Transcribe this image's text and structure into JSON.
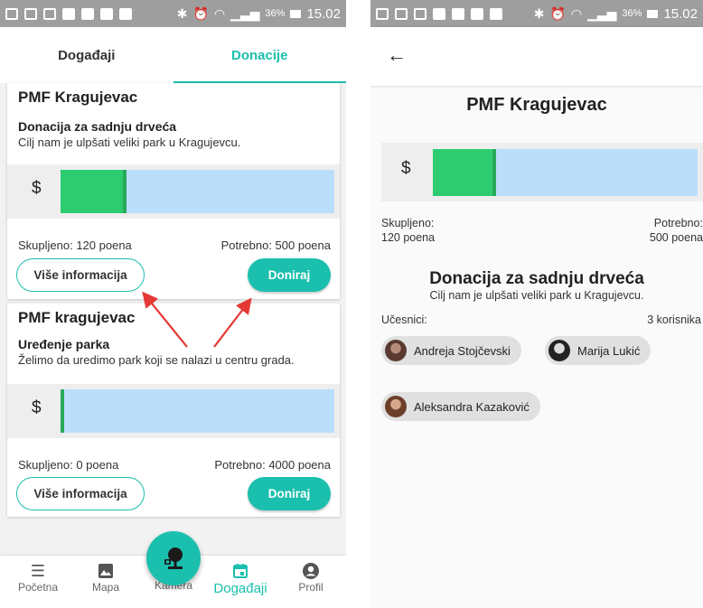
{
  "status_bar": {
    "battery": "36%",
    "time": "15.02"
  },
  "left_screen": {
    "tabs": [
      {
        "label": "Događaji",
        "active": false
      },
      {
        "label": "Donacije",
        "active": true
      }
    ],
    "cards": [
      {
        "organization": "PMF Kragujevac",
        "title": "Donacija za sadnju drveća",
        "description": "Cilj nam je ulpšati veliki park u Kragujevcu.",
        "currency_symbol": "$",
        "collected_label": "Skupljeno: 120 poena",
        "needed_label": "Potrebno: 500 poena",
        "progress_fraction": 0.24,
        "info_button": "Više informacija",
        "donate_button": "Doniraj"
      },
      {
        "organization": "PMF kragujevac",
        "title": "Uređenje parka",
        "description": "Želimo da uredimo park koji se nalazi u centru grada.",
        "currency_symbol": "$",
        "collected_label": "Skupljeno: 0 poena",
        "needed_label": "Potrebno: 4000 poena",
        "progress_fraction": 0.0,
        "info_button": "Više informacija",
        "donate_button": "Doniraj"
      }
    ],
    "bottom_nav": [
      {
        "label": "Početna",
        "icon": "list-icon",
        "active": false
      },
      {
        "label": "Mapa",
        "icon": "image-icon",
        "active": false
      },
      {
        "label": "Kamera",
        "icon": "camera-tree-icon",
        "active": false
      },
      {
        "label": "Događaji",
        "icon": "calendar-icon",
        "active": true
      },
      {
        "label": "Profil",
        "icon": "account-icon",
        "active": false
      }
    ]
  },
  "right_screen": {
    "organization": "PMF Kragujevac",
    "currency_symbol": "$",
    "progress_fraction": 0.24,
    "collected_label": "Skupljeno:",
    "collected_value": "120 poena",
    "needed_label": "Potrebno:",
    "needed_value": "500 poena",
    "title": "Donacija za sadnju drveća",
    "description": "Cilj nam je ulpšati veliki park u Kragujevcu.",
    "participants_label": "Učesnici:",
    "participants_count": "3 korisnika",
    "participants": [
      "Andreja Stojčevski",
      "Marija Lukić",
      "Aleksandra Kazaković"
    ]
  },
  "colors": {
    "accent": "#1bbfae",
    "progress_fill": "#2ecc71",
    "progress_track": "#bbdefb",
    "annotation_arrow": "#e53935"
  }
}
